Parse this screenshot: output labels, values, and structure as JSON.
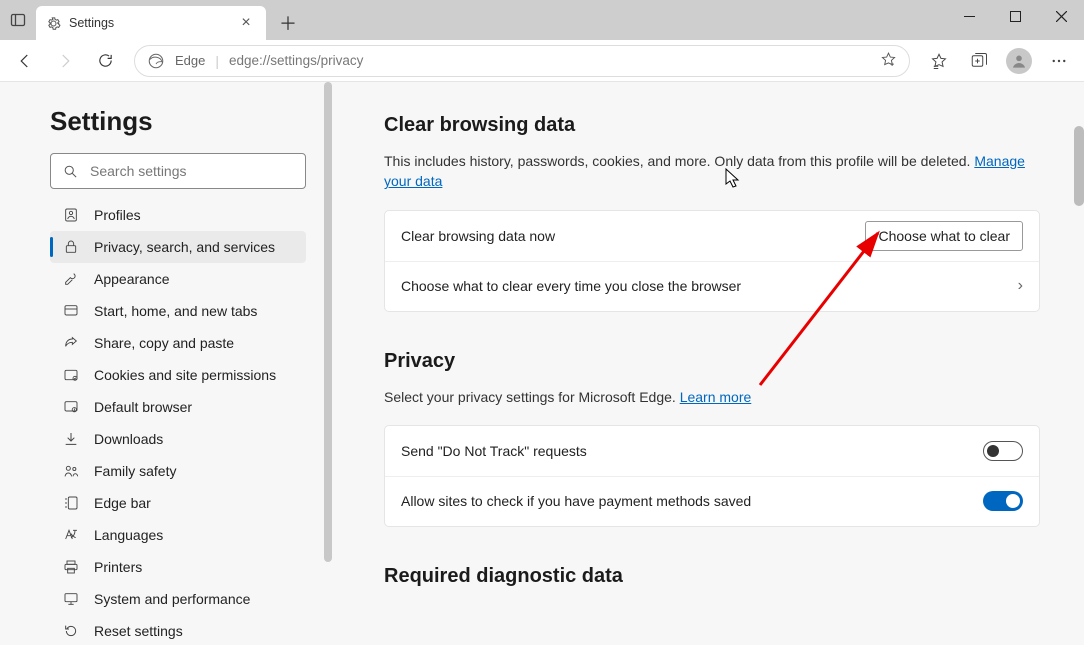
{
  "window": {
    "tab_title": "Settings",
    "edge_label": "Edge",
    "url": "edge://settings/privacy"
  },
  "sidebar": {
    "heading": "Settings",
    "search_placeholder": "Search settings",
    "items": [
      {
        "icon": "person-icon",
        "label": "Profiles"
      },
      {
        "icon": "lock-icon",
        "label": "Privacy, search, and services",
        "active": true
      },
      {
        "icon": "paint-icon",
        "label": "Appearance"
      },
      {
        "icon": "power-icon",
        "label": "Start, home, and new tabs"
      },
      {
        "icon": "share-icon",
        "label": "Share, copy and paste"
      },
      {
        "icon": "cookie-icon",
        "label": "Cookies and site permissions"
      },
      {
        "icon": "browser-icon",
        "label": "Default browser"
      },
      {
        "icon": "download-icon",
        "label": "Downloads"
      },
      {
        "icon": "family-icon",
        "label": "Family safety"
      },
      {
        "icon": "edgebar-icon",
        "label": "Edge bar"
      },
      {
        "icon": "language-icon",
        "label": "Languages"
      },
      {
        "icon": "printer-icon",
        "label": "Printers"
      },
      {
        "icon": "system-icon",
        "label": "System and performance"
      },
      {
        "icon": "reset-icon",
        "label": "Reset settings"
      }
    ]
  },
  "main": {
    "clear_browsing": {
      "title": "Clear browsing data",
      "desc_prefix": "This includes history, passwords, cookies, and more. Only data from this profile will be deleted. ",
      "desc_link": "Manage your data",
      "row1_label": "Clear browsing data now",
      "row1_button": "Choose what to clear",
      "row2_label": "Choose what to clear every time you close the browser"
    },
    "privacy": {
      "title": "Privacy",
      "desc_prefix": "Select your privacy settings for Microsoft Edge. ",
      "desc_link": "Learn more",
      "row1_label": "Send \"Do Not Track\" requests",
      "row2_label": "Allow sites to check if you have payment methods saved"
    },
    "diag": {
      "title": "Required diagnostic data"
    }
  }
}
